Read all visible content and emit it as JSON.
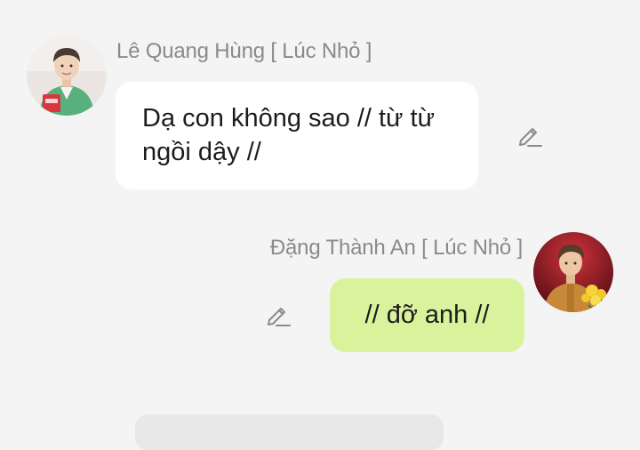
{
  "messages": [
    {
      "sender": "Lê Quang Hùng [ Lúc Nhỏ ]",
      "text": "Dạ con không sao // từ từ ngồi dậy //",
      "side": "left",
      "bubble_color": "#ffffff"
    },
    {
      "sender": "Đặng Thành An [ Lúc Nhỏ ]",
      "text": "// đỡ anh //",
      "side": "right",
      "bubble_color": "#d8f39b"
    }
  ],
  "icons": {
    "edit": "pencil-edit-icon"
  },
  "colors": {
    "background": "#f4f4f4",
    "sender_name": "#8a8a8a",
    "outgoing_bubble": "#d8f39b",
    "incoming_bubble": "#ffffff"
  }
}
